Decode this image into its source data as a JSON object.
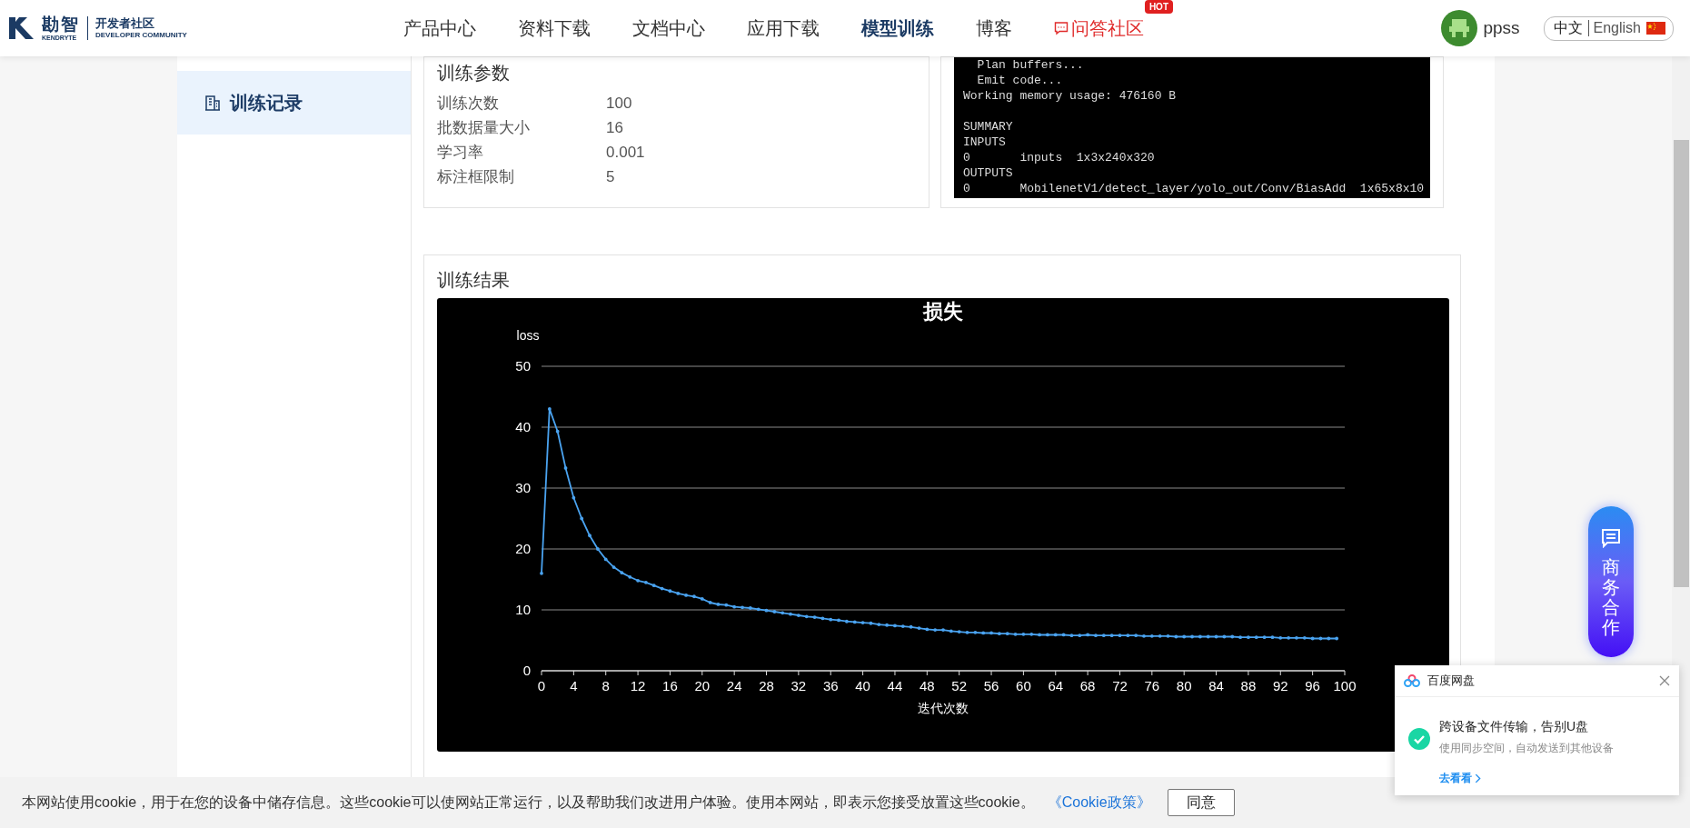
{
  "header": {
    "logo": {
      "name": "勘智",
      "sub": "KENDRYTE",
      "community": "开发者社区",
      "community_sub": "DEVELOPER COMMUNITY"
    },
    "nav": [
      {
        "label": "产品中心",
        "selected": false,
        "kind": "link"
      },
      {
        "label": "资料下载",
        "selected": false,
        "kind": "link"
      },
      {
        "label": "文档中心",
        "selected": false,
        "kind": "link"
      },
      {
        "label": "应用下载",
        "selected": false,
        "kind": "link"
      },
      {
        "label": "模型训练",
        "selected": true,
        "kind": "link"
      },
      {
        "label": "博客",
        "selected": false,
        "kind": "link"
      },
      {
        "label": "问答社区",
        "selected": false,
        "kind": "forum",
        "badge": "HOT"
      }
    ],
    "user": {
      "name": "ppss"
    },
    "languages": [
      {
        "label": "中文",
        "selected": true
      },
      {
        "label": "English",
        "selected": false
      }
    ]
  },
  "sidebar": {
    "items": [
      {
        "label": "训练记录",
        "selected": true
      }
    ]
  },
  "params": {
    "title": "训练参数",
    "rows": [
      {
        "label": "训练次数",
        "value": "100"
      },
      {
        "label": "批数据量大小",
        "value": "16"
      },
      {
        "label": "学习率",
        "value": "0.001"
      },
      {
        "label": "标注框限制",
        "value": "5"
      }
    ]
  },
  "terminal": {
    "blocks": [
      [
        "  Plan buffers...",
        "  Emit code...",
        "Working memory usage: 476160 B"
      ],
      [
        "SUMMARY",
        "INPUTS",
        "0       inputs  1x3x240x320",
        "OUTPUTS",
        "0       MobilenetV1/detect_layer/yolo_out/Conv/BiasAdd  1x65x8x10"
      ]
    ]
  },
  "results": {
    "title": "训练结果",
    "chart_data": {
      "type": "line",
      "title": "损失",
      "xlabel": "迭代次数",
      "ylabel": "loss",
      "grid": true,
      "xlim": [
        0,
        100
      ],
      "ylim": [
        0,
        50
      ],
      "x": [
        0,
        1,
        2,
        3,
        4,
        5,
        6,
        7,
        8,
        9,
        10,
        11,
        12,
        13,
        14,
        15,
        16,
        17,
        18,
        19,
        20,
        21,
        22,
        23,
        24,
        25,
        26,
        27,
        28,
        29,
        30,
        31,
        32,
        33,
        34,
        35,
        36,
        37,
        38,
        39,
        40,
        41,
        42,
        43,
        44,
        45,
        46,
        47,
        48,
        49,
        50,
        51,
        52,
        53,
        54,
        55,
        56,
        57,
        58,
        59,
        60,
        61,
        62,
        63,
        64,
        65,
        66,
        67,
        68,
        69,
        70,
        71,
        72,
        73,
        74,
        75,
        76,
        77,
        78,
        79,
        80,
        81,
        82,
        83,
        84,
        85,
        86,
        87,
        88,
        89,
        90,
        91,
        92,
        93,
        94,
        95,
        96,
        97,
        98,
        99
      ],
      "xticks": [
        0,
        4,
        8,
        12,
        16,
        20,
        24,
        28,
        32,
        36,
        40,
        44,
        48,
        52,
        56,
        60,
        64,
        68,
        72,
        76,
        80,
        84,
        88,
        92,
        96,
        100
      ],
      "yticks": [
        0,
        10,
        20,
        30,
        40,
        50
      ],
      "series": [
        {
          "color": "#4aa3f0",
          "values": [
            16,
            43,
            39.3,
            33.3,
            28.4,
            25,
            22.2,
            20,
            18.3,
            17,
            16.1,
            15.4,
            14.8,
            14.5,
            14,
            13.5,
            13.1,
            12.7,
            12.4,
            12.2,
            11.8,
            11.2,
            10.9,
            10.8,
            10.5,
            10.4,
            10.3,
            10.1,
            9.9,
            9.7,
            9.5,
            9.3,
            9.1,
            8.9,
            8.8,
            8.6,
            8.4,
            8.3,
            8.1,
            8.0,
            7.9,
            7.8,
            7.6,
            7.5,
            7.4,
            7.3,
            7.2,
            7.0,
            6.8,
            6.7,
            6.7,
            6.5,
            6.4,
            6.3,
            6.3,
            6.2,
            6.2,
            6.1,
            6.1,
            6.0,
            6.0,
            6.0,
            5.9,
            5.9,
            5.9,
            5.9,
            5.8,
            5.8,
            5.9,
            5.8,
            5.8,
            5.8,
            5.8,
            5.8,
            5.8,
            5.7,
            5.7,
            5.7,
            5.7,
            5.6,
            5.6,
            5.6,
            5.6,
            5.6,
            5.6,
            5.6,
            5.6,
            5.5,
            5.5,
            5.5,
            5.5,
            5.5,
            5.4,
            5.4,
            5.4,
            5.4,
            5.3,
            5.3,
            5.3,
            5.3
          ]
        }
      ]
    }
  },
  "float_button": {
    "label": "商务合作"
  },
  "notification": {
    "app": "百度网盘",
    "title": "跨设备文件传输，告别U盘",
    "text": "使用同步空间，自动发送到其他设备",
    "link": "去看看"
  },
  "cookie_bar": {
    "text": "本网站使用cookie，用于在您的设备中储存信息。这些cookie可以使网站正常运行，以及帮助我们改进用户体验。使用本网站，即表示您接受放置这些cookie。",
    "link": "《Cookie政策》",
    "button": "同意"
  }
}
